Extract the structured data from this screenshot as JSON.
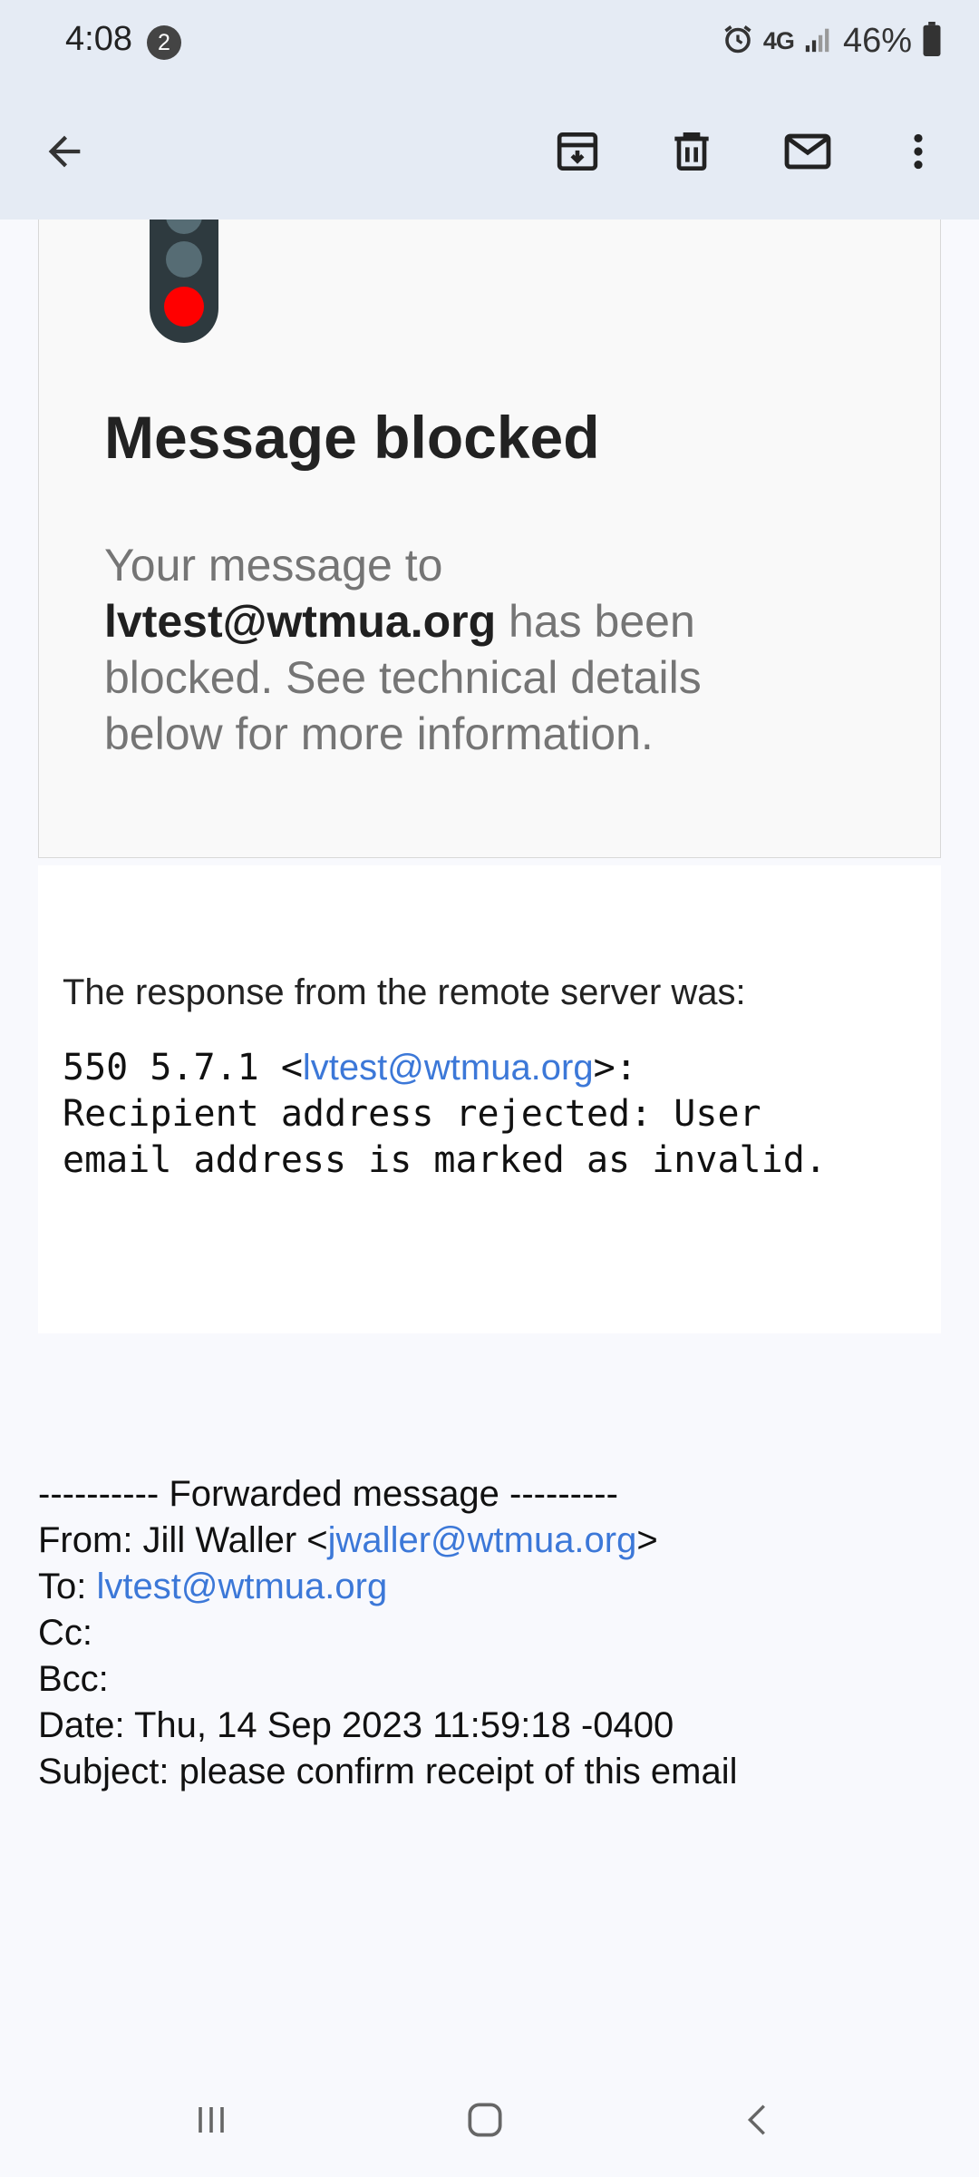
{
  "status_bar": {
    "time": "4:08",
    "notification_count": "2",
    "network": "4G",
    "battery": "46%"
  },
  "toolbar": {
    "back_icon": "arrow-back-icon",
    "archive_icon": "archive-icon",
    "delete_icon": "trash-icon",
    "mark_unread_icon": "mail-icon",
    "more_icon": "more-vert-icon"
  },
  "block_notice": {
    "icon": "traffic-light-red-icon",
    "title": "Message blocked",
    "text_before": "Your message to ",
    "recipient": "lvtest@wtmua.org",
    "text_after": " has been blocked. See technical details below for more information."
  },
  "technical_details": {
    "label": "The response from the remote server was:",
    "code_prefix": "550 5.7.1 <",
    "code_email": "lvtest@wtmua.org",
    "code_suffix": ">:",
    "line2": "Recipient address rejected: User",
    "line3": "email address is marked as invalid."
  },
  "forwarded": {
    "header": "---------- Forwarded message ---------",
    "from_label": "From: Jill Waller <",
    "from_email": "jwaller@wtmua.org",
    "from_close": ">",
    "to_label": "To: ",
    "to_email": "lvtest@wtmua.org",
    "cc": "Cc:",
    "bcc": "Bcc:",
    "date": "Date: Thu, 14 Sep 2023 11:59:18 -0400",
    "subject": "Subject: please confirm receipt of this email"
  },
  "nav_bar": {
    "recents_icon": "recents-icon",
    "home_icon": "home-icon",
    "back_icon": "nav-back-icon"
  },
  "colors": {
    "header_bg": "#e5ebf4",
    "link": "#3c78d8",
    "traffic_red": "#ff0000"
  }
}
